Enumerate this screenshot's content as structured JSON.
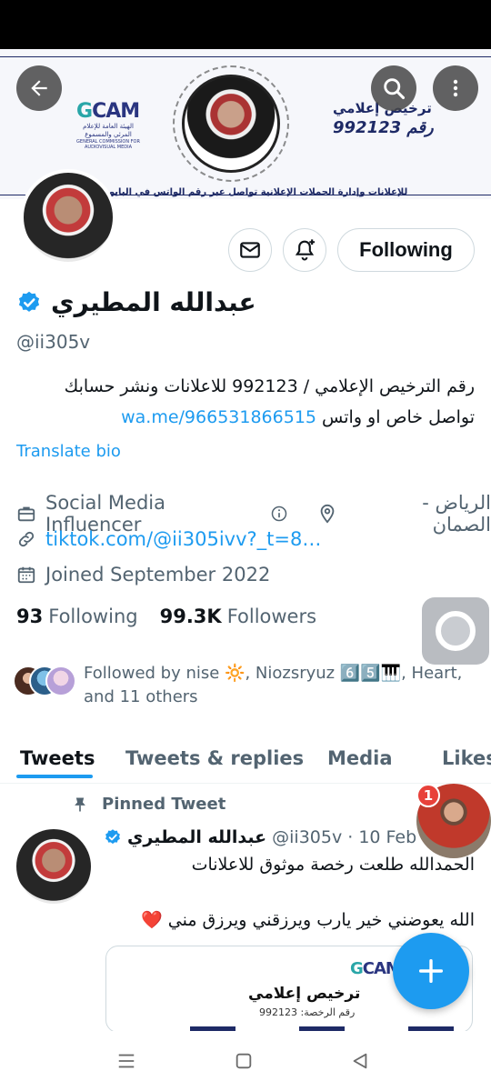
{
  "banner": {
    "gcam_logo_g": "G",
    "gcam_logo_rest": "CAM",
    "gcam_arabic": "الهيئة العامة للإعلام المرئي والمسموع",
    "gcam_english": "GENERAL COMMISSION FOR AUDIOVISUAL MEDIA",
    "license_title": "ترخيص إعلامي",
    "license_number": "رقم 992123",
    "strip_text": "للإعلانات وإدارة الحملات الإعلانية تواصل عبر رقم الواتس في البايو"
  },
  "header_buttons": {
    "back_icon": "arrow-left-icon",
    "search_icon": "search-icon",
    "more_icon": "more-vertical-icon"
  },
  "actions": {
    "message_icon": "envelope-icon",
    "notify_icon": "bell-plus-icon",
    "following_label": "Following"
  },
  "profile": {
    "name": "عبدالله المطيري",
    "verified_color": "#1d9bf0",
    "handle": "@ii305v",
    "bio_line1": "رقم الترخيص الإعلامي / 992123 للاعلانات ونشر حسابك",
    "bio_line2_text": "تواصل خاص او واتس ",
    "bio_line2_link": "wa.me/966531866515",
    "translate_label": "Translate bio",
    "category": "Social Media Influencer",
    "location": "الرياض - الصمان",
    "website": "tiktok.com/@ii305ivv?_t=8…",
    "joined": "Joined September 2022",
    "following_count": "93",
    "following_label": "Following",
    "followers_count": "99.3K",
    "followers_label": "Followers",
    "followed_by": "Followed by nise 🔆, Niozsryuz 6️⃣5️⃣🎹, Heart, and 11 others"
  },
  "tabs": [
    "Tweets",
    "Tweets & replies",
    "Media",
    "Likes"
  ],
  "tweet": {
    "pinned_label": "Pinned Tweet",
    "author_name": "عبدالله المطيري",
    "author_meta": "@ii305v · 10 Feb",
    "line1": "الحمدالله طلعت رخصة موثوق للاعلانات",
    "line2": "الله يعوضني خير يارب ويرزقني ويرزق مني ❤️",
    "card_logo_g": "G",
    "card_logo_rest": "CAM",
    "card_title": "ترخيص إعلامي",
    "card_subtitle": "رقم الرخصة: 992123"
  },
  "notification": {
    "badge_count": "1"
  },
  "fab": {
    "icon": "plus-icon"
  },
  "system_nav": {
    "recents_icon": "menu-lines-icon",
    "home_icon": "square-icon",
    "back_icon": "triangle-back-icon"
  },
  "colors": {
    "accent": "#1d9bf0",
    "text": "#0f1419",
    "muted": "#536471",
    "border": "#cfd9de"
  }
}
